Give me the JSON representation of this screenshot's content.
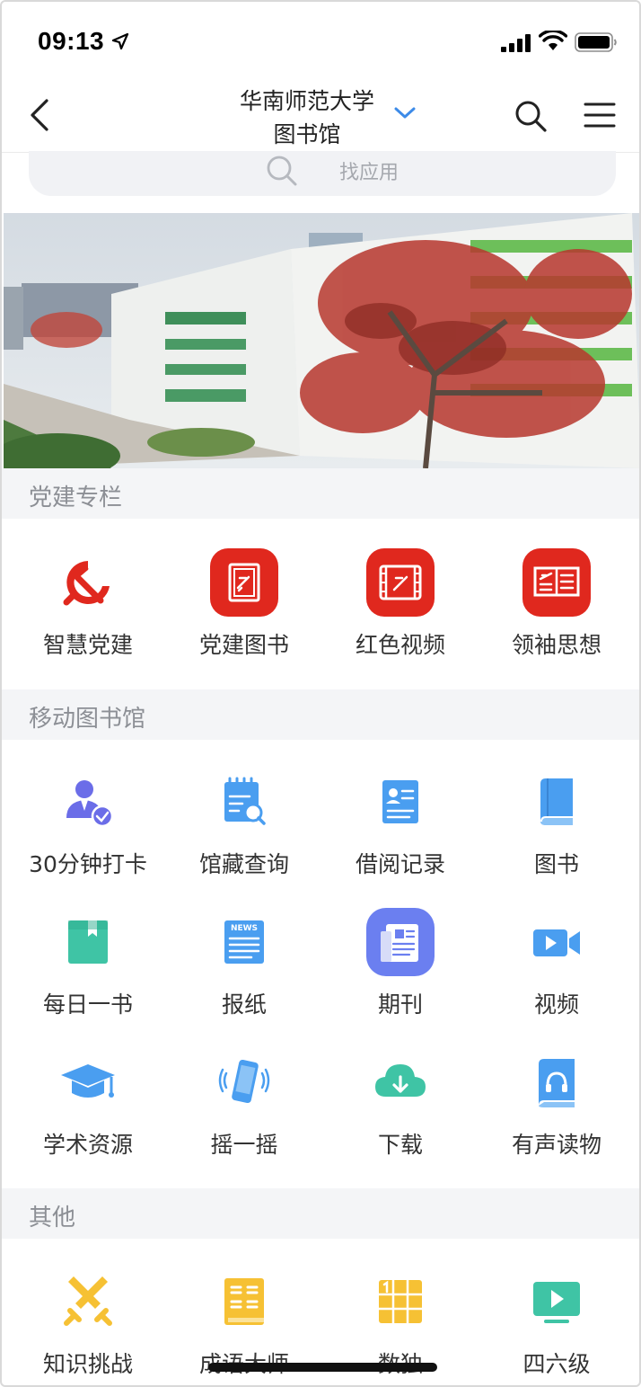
{
  "status_bar": {
    "time": "09:13"
  },
  "nav": {
    "title_line1": "华南师范大学",
    "title_line2": "图书馆"
  },
  "search": {
    "placeholder": "找应用"
  },
  "sections": {
    "party": {
      "title": "党建专栏",
      "items": [
        {
          "label": "智慧党建",
          "icon": "party-emblem-icon"
        },
        {
          "label": "党建图书",
          "icon": "party-book-icon"
        },
        {
          "label": "红色视频",
          "icon": "red-video-icon"
        },
        {
          "label": "领袖思想",
          "icon": "leader-thought-icon"
        }
      ]
    },
    "mobile_library": {
      "title": "移动图书馆",
      "items": [
        {
          "label": "30分钟打卡",
          "icon": "check-in-icon"
        },
        {
          "label": "馆藏查询",
          "icon": "catalog-search-icon"
        },
        {
          "label": "借阅记录",
          "icon": "borrow-record-icon"
        },
        {
          "label": "图书",
          "icon": "book-icon"
        },
        {
          "label": "每日一书",
          "icon": "daily-book-icon"
        },
        {
          "label": "报纸",
          "icon": "newspaper-icon"
        },
        {
          "label": "期刊",
          "icon": "journal-icon"
        },
        {
          "label": "视频",
          "icon": "video-icon"
        },
        {
          "label": "学术资源",
          "icon": "academic-cap-icon"
        },
        {
          "label": "摇一摇",
          "icon": "shake-phone-icon"
        },
        {
          "label": "下载",
          "icon": "cloud-download-icon"
        },
        {
          "label": "有声读物",
          "icon": "audiobook-icon"
        }
      ]
    },
    "other": {
      "title": "其他",
      "items": [
        {
          "label": "知识挑战",
          "icon": "crossed-swords-icon"
        },
        {
          "label": "成语大师",
          "icon": "idiom-master-icon"
        },
        {
          "label": "数独",
          "icon": "sudoku-icon"
        },
        {
          "label": "四六级",
          "icon": "cet-video-icon"
        }
      ]
    }
  },
  "colors": {
    "party_red": "#e0281e",
    "section_bg": "#f4f5f7",
    "accent_blue": "#3d8be8",
    "icon_blue": "#4a9ef0",
    "icon_teal": "#3fc4a5",
    "icon_yellow": "#f6c134",
    "icon_purple": "#6b6de8"
  }
}
